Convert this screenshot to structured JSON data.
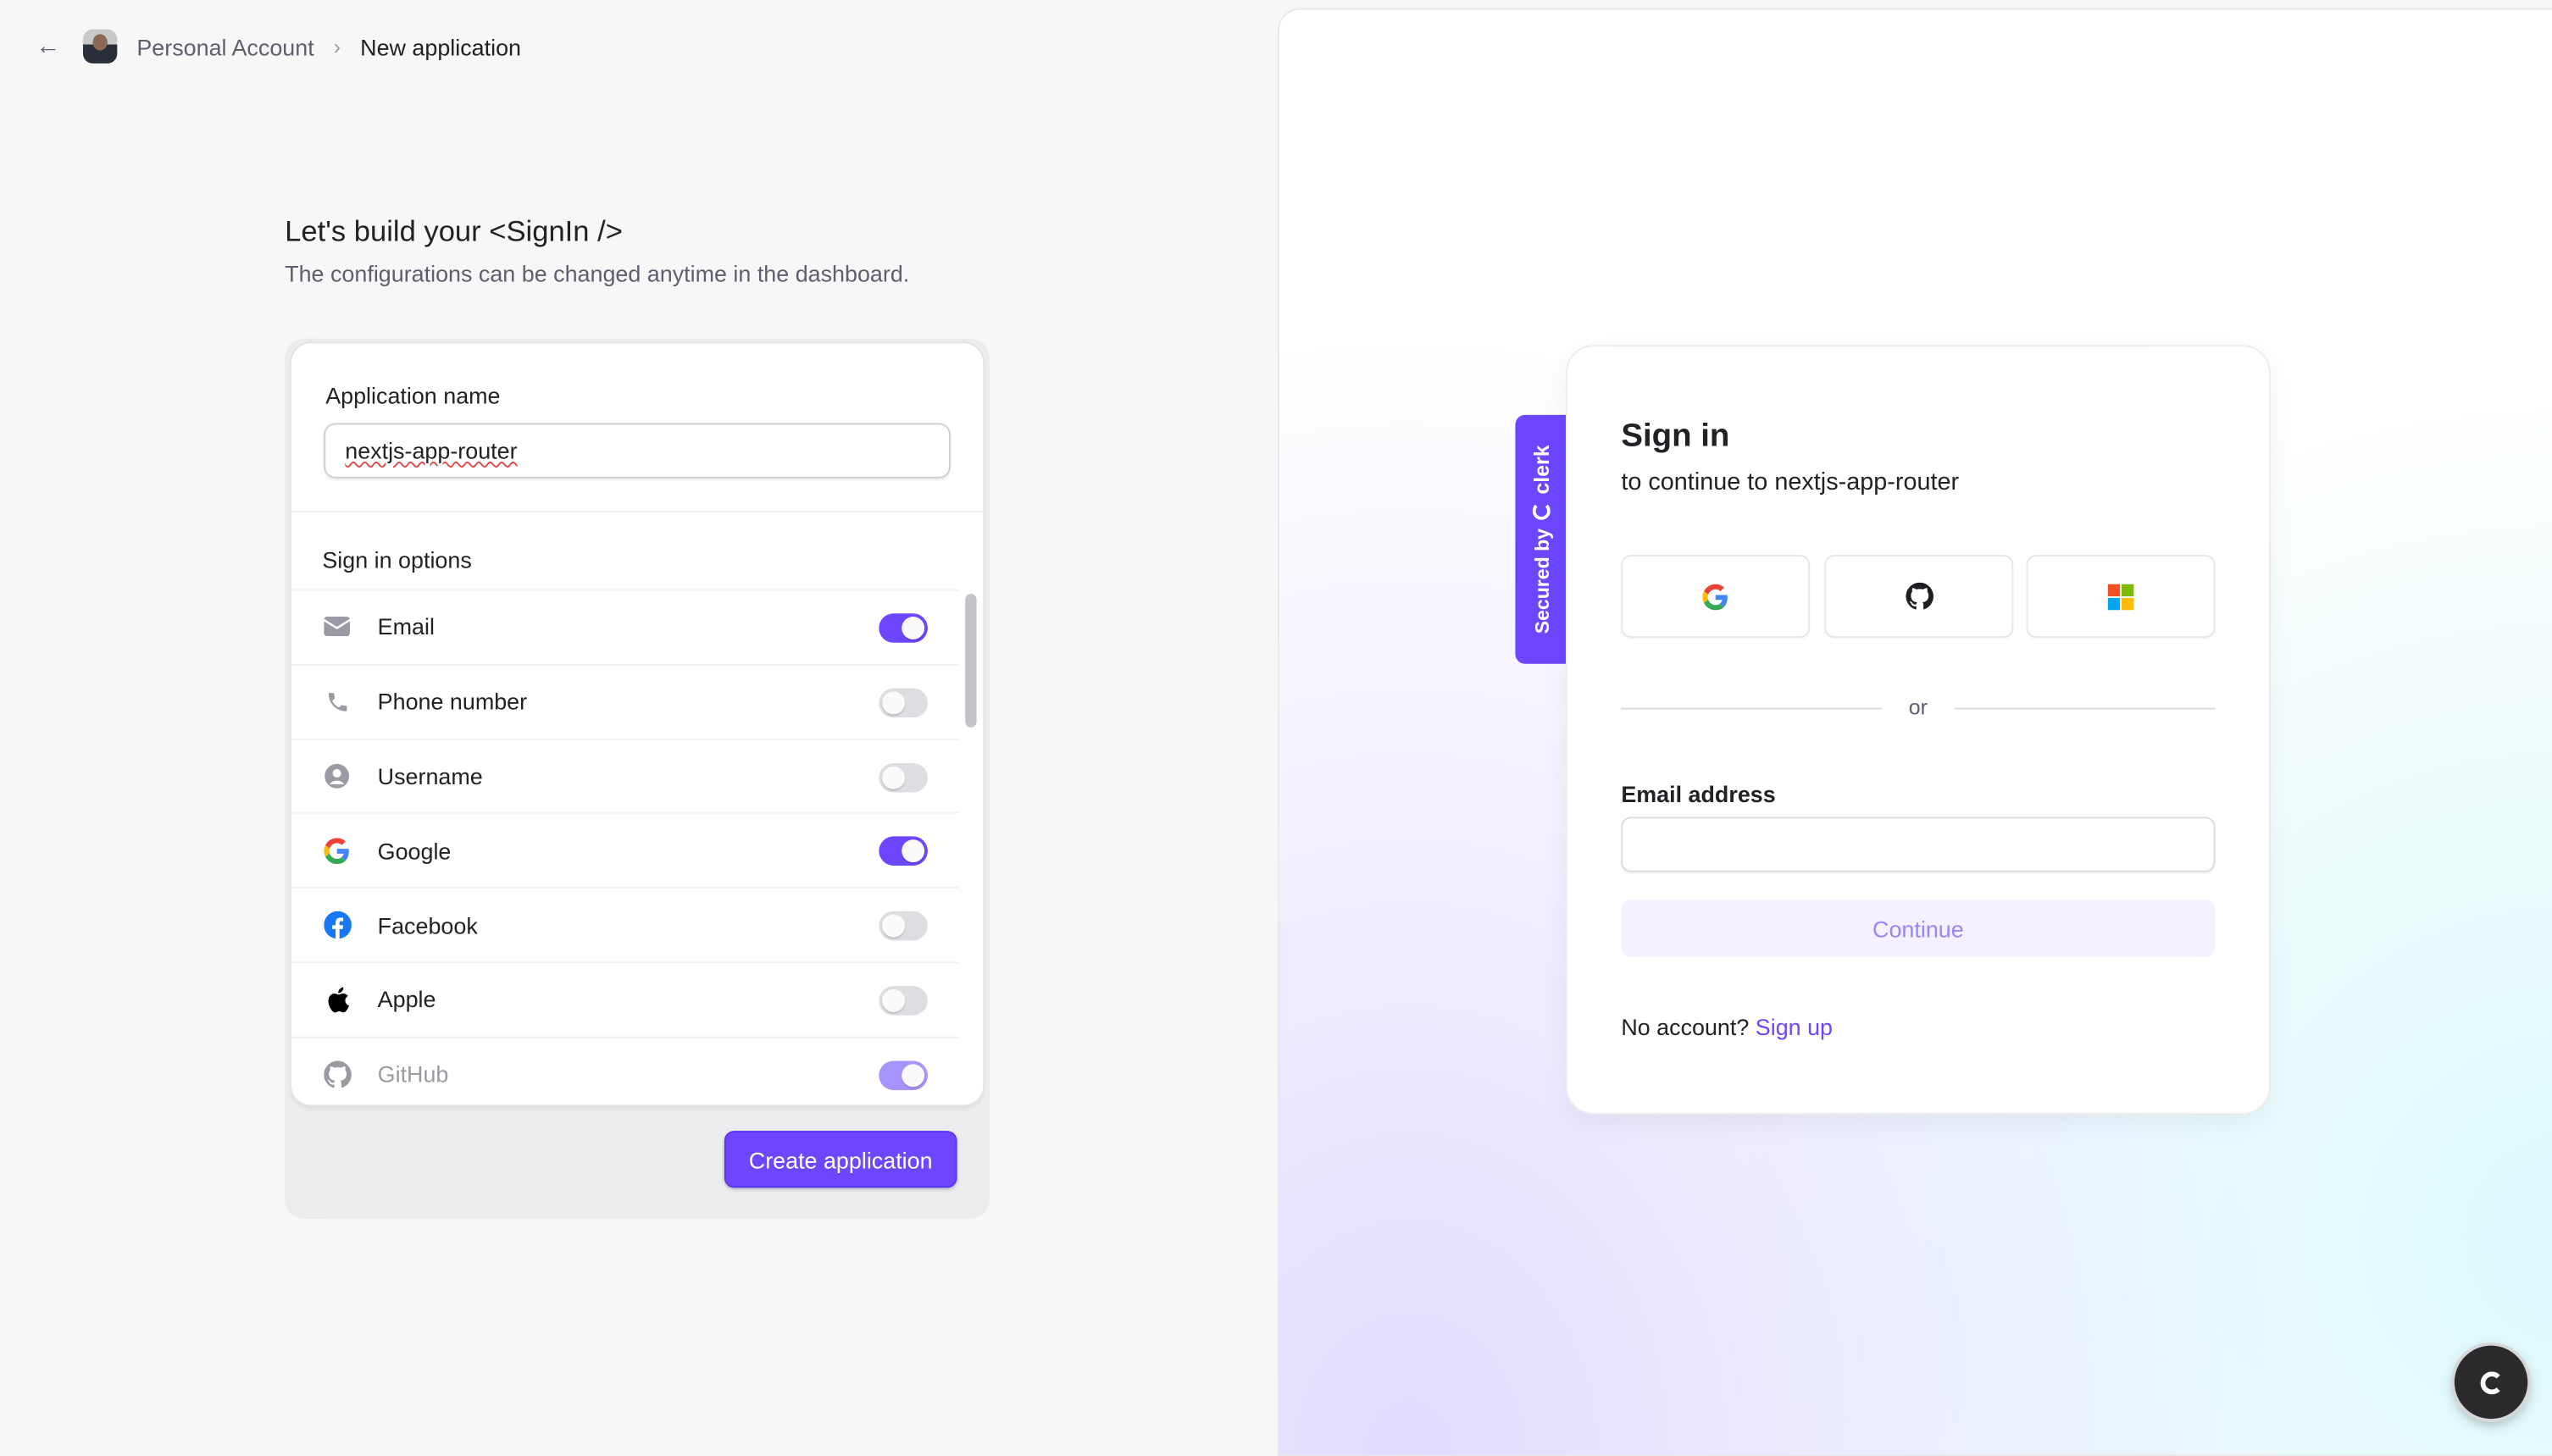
{
  "breadcrumb": {
    "back_icon": "arrow-left-icon",
    "account": "Personal Account",
    "current": "New application"
  },
  "heading": {
    "title": "Let's build your <SignIn />",
    "subtitle": "The configurations can be changed anytime in the dashboard."
  },
  "form": {
    "app_name_label": "Application name",
    "app_name_value": "nextjs-app-router",
    "options_label": "Sign in options",
    "options": [
      {
        "label": "Email",
        "icon": "mail-icon",
        "enabled": true
      },
      {
        "label": "Phone number",
        "icon": "phone-icon",
        "enabled": false
      },
      {
        "label": "Username",
        "icon": "user-circle-icon",
        "enabled": false
      },
      {
        "label": "Google",
        "icon": "google-icon",
        "enabled": true
      },
      {
        "label": "Facebook",
        "icon": "facebook-icon",
        "enabled": false
      },
      {
        "label": "Apple",
        "icon": "apple-icon",
        "enabled": false
      },
      {
        "label": "GitHub",
        "icon": "github-icon",
        "enabled": true
      }
    ],
    "create_label": "Create application"
  },
  "preview": {
    "badge": "Secured by",
    "badge_brand": "clerk",
    "title": "Sign in",
    "subtitle": "to continue to nextjs-app-router",
    "social": [
      "google-icon",
      "github-icon",
      "microsoft-icon"
    ],
    "or": "or",
    "email_label": "Email address",
    "email_value": "",
    "continue_label": "Continue",
    "no_account": "No account?",
    "sign_up": "Sign up"
  },
  "colors": {
    "accent": "#6c47ff",
    "background": "#f7f7f7"
  }
}
